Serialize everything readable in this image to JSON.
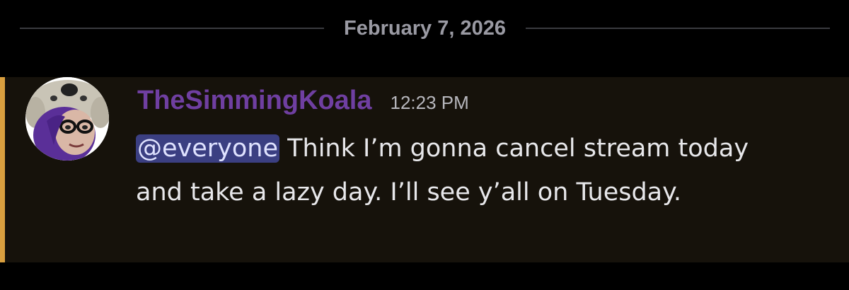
{
  "divider": {
    "date": "February 7, 2026"
  },
  "message": {
    "author": "TheSimmingKoala",
    "timestamp": "12:23 PM",
    "mention": "@everyone",
    "text": " Think I’m gonna cancel stream today and take a lazy day. I’ll see y’all on Tuesday."
  },
  "colors": {
    "background": "#000000",
    "message_highlight": "#16120b",
    "mention_bar": "#d99f3f",
    "username": "#6f3fa1",
    "mention_bg": "#3b3f82",
    "date_text": "#9a9aa3"
  }
}
